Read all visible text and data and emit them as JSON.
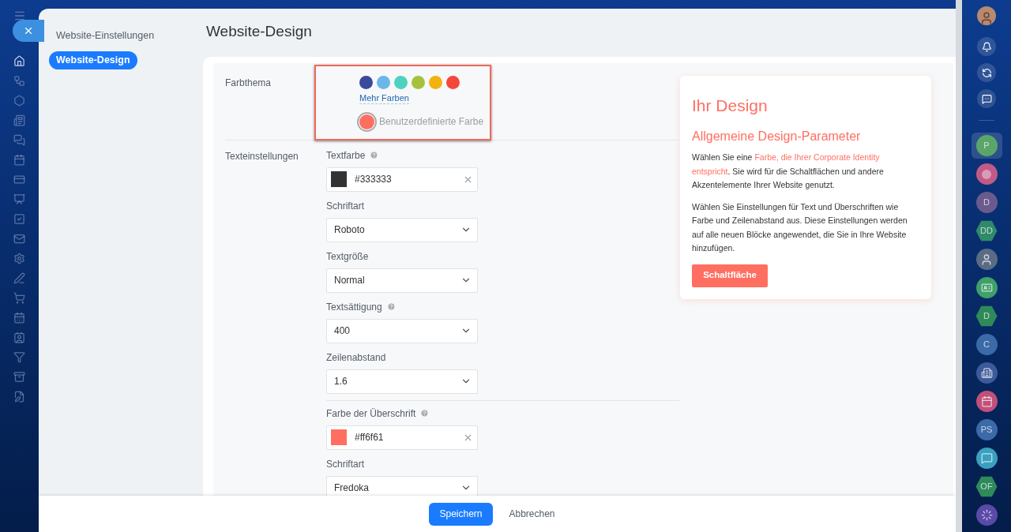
{
  "nav": {
    "items": [
      {
        "label": "Website-Einstellungen",
        "selected": false
      },
      {
        "label": "Website-Design",
        "selected": true
      }
    ]
  },
  "page_title": "Website-Design",
  "color_theme": {
    "label": "Farbthema",
    "swatches": [
      {
        "color": "#3a4a9a",
        "selected": false
      },
      {
        "color": "#6bb7ea",
        "selected": false
      },
      {
        "color": "#4fd1c0",
        "selected": false
      },
      {
        "color": "#a5c23d",
        "selected": false
      },
      {
        "color": "#f4b20f",
        "selected": false
      },
      {
        "color": "#f4483b",
        "selected": false
      }
    ],
    "more_link": "Mehr Farben",
    "custom": {
      "label": "Benutzerdefinierte Farbe",
      "color": "#ff6f61",
      "selected": true
    }
  },
  "text_settings": {
    "label": "Texteinstellungen",
    "fields": [
      {
        "kind": "color",
        "label": "Textfarbe",
        "help": true,
        "value": "#333333",
        "color": "#333333"
      },
      {
        "kind": "select",
        "label": "Schriftart",
        "help": false,
        "value": "Roboto"
      },
      {
        "kind": "select",
        "label": "Textgröße",
        "help": false,
        "value": "Normal"
      },
      {
        "kind": "select",
        "label": "Textsättigung",
        "help": true,
        "value": "400"
      },
      {
        "kind": "select",
        "label": "Zeilenabstand",
        "help": false,
        "value": "1.6"
      },
      {
        "kind": "divider"
      },
      {
        "kind": "color",
        "label": "Farbe der Überschrift",
        "help": true,
        "value": "#ff6f61",
        "color": "#ff6f61"
      },
      {
        "kind": "select",
        "label": "Schriftart",
        "help": false,
        "value": "Fredoka"
      }
    ]
  },
  "preview": {
    "title": "Ihr Design",
    "subtitle": "Allgemeine Design-Parameter",
    "paragraph_1_start": "Wählen Sie eine ",
    "paragraph_1_link": "Farbe, die Ihrer Corporate Identity",
    "paragraph_1_link_2": "entspricht",
    "paragraph_1_end": ". Sie wird für die Schaltflächen und andere Akzentelemente Ihrer Website genutzt.",
    "paragraph_2": "Wählen Sie Einstellungen für Text und Überschriften wie Farbe und Zeilenabstand aus. Diese Einstellungen werden auf alle neuen Blöcke angewendet, die Sie in Ihre Website hinzufügen.",
    "button": "Schaltfläche"
  },
  "footer": {
    "buttons": [
      {
        "label": "Speichern",
        "kind": "primary"
      },
      {
        "label": "Abbrechen",
        "kind": "secondary"
      }
    ]
  },
  "right_bar": {
    "items": [
      {
        "kind": "letter",
        "text": "P",
        "color": "#5aa66a",
        "selected": true
      },
      {
        "kind": "alert",
        "color": "#c05a86",
        "selected": false
      },
      {
        "kind": "letter",
        "text": "D",
        "color": "#6b5a8e",
        "selected": false
      },
      {
        "kind": "hex",
        "text": "DD",
        "color": "#2f8a6a",
        "selected": false
      },
      {
        "kind": "person",
        "color": "#5b6b85",
        "selected": false
      },
      {
        "kind": "card",
        "color": "#3fa06a",
        "selected": false
      },
      {
        "kind": "hex",
        "text": "D",
        "color": "#2f8a5a",
        "selected": false
      },
      {
        "kind": "letter",
        "text": "C",
        "color": "#3a6aa8",
        "selected": false
      },
      {
        "kind": "building",
        "color": "#3d5a9a",
        "selected": false
      },
      {
        "kind": "calendar",
        "color": "#c0507a",
        "selected": false
      },
      {
        "kind": "letter",
        "text": "PS",
        "color": "#3a6aa8",
        "selected": false
      },
      {
        "kind": "chat",
        "color": "#3aa0c0",
        "selected": false
      },
      {
        "kind": "hex",
        "text": "OF",
        "color": "#2f8a5a",
        "selected": false
      },
      {
        "kind": "spiral",
        "color": "#5a4aa8",
        "selected": false
      }
    ]
  }
}
